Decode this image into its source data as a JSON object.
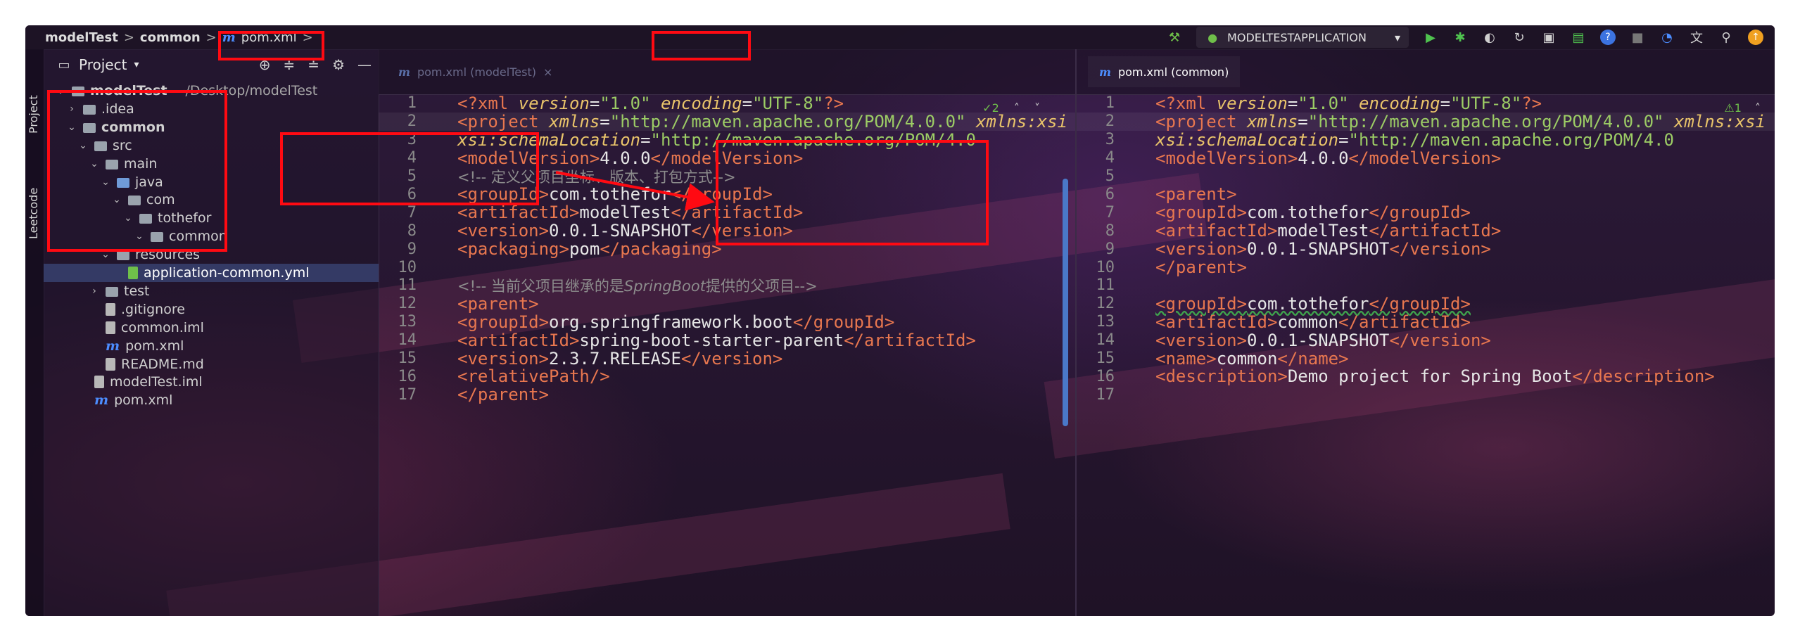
{
  "breadcrumb": {
    "items": [
      "modelTest",
      "common",
      "pom.xml"
    ],
    "separator": ">"
  },
  "toolbar": {
    "run_config": "MODELTESTAPPLICATION",
    "icons": [
      "hammer-icon",
      "run-config-icon",
      "run-icon",
      "debug-icon",
      "coverage-icon",
      "profile-icon",
      "build-icon",
      "layout-icon",
      "help-icon",
      "stop-icon",
      "search-everywhere-icon",
      "translate-icon",
      "search-icon",
      "update-icon"
    ]
  },
  "toolstrip": {
    "project_label": "Project",
    "leetcode_label": "Leetcode"
  },
  "project_panel": {
    "title": "Project",
    "tree": [
      {
        "label": "modelTest",
        "suffix": "~/Desktop/modelTest",
        "level": 0,
        "expanded": true,
        "kind": "folder"
      },
      {
        "label": ".idea",
        "level": 1,
        "expanded": false,
        "kind": "folder"
      },
      {
        "label": "common",
        "level": 1,
        "expanded": true,
        "kind": "module"
      },
      {
        "label": "src",
        "level": 2,
        "expanded": true,
        "kind": "folder"
      },
      {
        "label": "main",
        "level": 3,
        "expanded": true,
        "kind": "folder"
      },
      {
        "label": "java",
        "level": 4,
        "expanded": true,
        "kind": "source"
      },
      {
        "label": "com",
        "level": 5,
        "expanded": true,
        "kind": "package"
      },
      {
        "label": "tothefor",
        "level": 6,
        "expanded": true,
        "kind": "package"
      },
      {
        "label": "common",
        "level": 7,
        "expanded": true,
        "kind": "package"
      },
      {
        "label": "resources",
        "level": 4,
        "expanded": true,
        "kind": "resources"
      },
      {
        "label": "application-common.yml",
        "level": 5,
        "kind": "yml",
        "selected": true
      },
      {
        "label": "test",
        "level": 3,
        "expanded": false,
        "kind": "folder"
      },
      {
        "label": ".gitignore",
        "level": 3,
        "kind": "file"
      },
      {
        "label": "common.iml",
        "level": 3,
        "kind": "file"
      },
      {
        "label": "pom.xml",
        "level": 3,
        "kind": "maven"
      },
      {
        "label": "README.md",
        "level": 3,
        "kind": "file"
      },
      {
        "label": "modelTest.iml",
        "level": 2,
        "kind": "file"
      },
      {
        "label": "pom.xml",
        "level": 2,
        "kind": "maven"
      }
    ]
  },
  "left_editor": {
    "tab_label": "pom.xml (modelTest)",
    "inspection_count": "2",
    "lines": [
      {
        "n": "1",
        "html": "<span class='tag'>&lt;?xml </span><span class='attr'>version</span><span class='txt'>=</span><span class='str'>\"1.0\" </span><span class='attr'>encoding</span><span class='txt'>=</span><span class='str'>\"UTF-8\"</span><span class='tag'>?&gt;</span>"
      },
      {
        "n": "2",
        "html": "<span class='tag'>&lt;project </span><span class='attr'>xmlns</span><span class='txt'>=</span><span class='str'>\"http://maven.apache.org/POM/4.0.0\" </span><span class='attr'>xmlns:xsi</span>"
      },
      {
        "n": "3",
        "html": "<span class='txt'>         </span><span class='attr'>xsi:schemaLocation</span><span class='txt'>=</span><span class='str'>\"http://maven.apache.org/POM/4.0</span>"
      },
      {
        "n": "4",
        "html": "<span class='txt'>    </span><span class='tag'>&lt;modelVersion&gt;</span><span class='txt'>4.0.0</span><span class='tag'>&lt;/modelVersion&gt;</span>"
      },
      {
        "n": "5",
        "html": "<span class='txt'>    </span><span class='cmt'>&lt;!--     定义父项目坐标、版本、打包方式--&gt;</span>"
      },
      {
        "n": "6",
        "html": "<span class='txt'>    </span><span class='tag'>&lt;groupId&gt;</span><span class='txt'>com.tothefor</span><span class='tag'>&lt;/groupId&gt;</span>"
      },
      {
        "n": "7",
        "html": "<span class='txt'>    </span><span class='tag'>&lt;artifactId&gt;</span><span class='txt'>modelTest</span><span class='tag'>&lt;/artifactId&gt;</span>"
      },
      {
        "n": "8",
        "html": "<span class='txt'>    </span><span class='tag'>&lt;version&gt;</span><span class='txt'>0.0.1-SNAPSHOT</span><span class='tag'>&lt;/version&gt;</span>"
      },
      {
        "n": "9",
        "html": "<span class='txt'>    </span><span class='tag'>&lt;packaging&gt;</span><span class='txt'>pom</span><span class='tag'>&lt;/packaging&gt;</span>"
      },
      {
        "n": "10",
        "html": ""
      },
      {
        "n": "11",
        "html": "<span class='txt'>    </span><span class='cmt'>&lt;!--     当前父项目继承的是<i>SpringBoot</i>提供的父项目--&gt;</span>"
      },
      {
        "n": "12",
        "html": "<span class='txt'>    </span><span class='tag'>&lt;parent&gt;</span>"
      },
      {
        "n": "13",
        "html": "<span class='txt'>        </span><span class='tag'>&lt;groupId&gt;</span><span class='txt'>org.springframework.boot</span><span class='tag'>&lt;/groupId&gt;</span>"
      },
      {
        "n": "14",
        "html": "<span class='txt'>        </span><span class='tag'>&lt;artifactId&gt;</span><span class='txt'>spring-boot-starter-parent</span><span class='tag'>&lt;/artifactId&gt;</span>"
      },
      {
        "n": "15",
        "html": "<span class='txt'>        </span><span class='tag'>&lt;version&gt;</span><span class='txt'>2.3.7.RELEASE</span><span class='tag'>&lt;/version&gt;</span>"
      },
      {
        "n": "16",
        "html": "<span class='txt'>        </span><span class='tag'>&lt;relativePath/&gt;</span>"
      },
      {
        "n": "17",
        "html": "<span class='txt'>    </span><span class='tag'>&lt;/parent&gt;</span>"
      }
    ]
  },
  "right_editor": {
    "tab_label": "pom.xml (common)",
    "inspection_count": "1",
    "lines": [
      {
        "n": "1",
        "html": "<span class='tag'>&lt;?xml </span><span class='attr'>version</span><span class='txt'>=</span><span class='str'>\"1.0\" </span><span class='attr'>encoding</span><span class='txt'>=</span><span class='str'>\"UTF-8\"</span><span class='tag'>?&gt;</span>"
      },
      {
        "n": "2",
        "html": "<span class='tag'>&lt;project </span><span class='attr'>xmlns</span><span class='txt'>=</span><span class='str'>\"http://maven.apache.org/POM/4.0.0\" </span><span class='attr'>xmlns:xsi</span>"
      },
      {
        "n": "3",
        "html": "<span class='txt'>         </span><span class='attr'>xsi:schemaLocation</span><span class='txt'>=</span><span class='str'>\"http://maven.apache.org/POM/4.0</span>"
      },
      {
        "n": "4",
        "html": "<span class='txt'>    </span><span class='tag'>&lt;modelVersion&gt;</span><span class='txt'>4.0.0</span><span class='tag'>&lt;/modelVersion&gt;</span>"
      },
      {
        "n": "5",
        "html": ""
      },
      {
        "n": "6",
        "html": "<span class='txt'>    </span><span class='tag'>&lt;parent&gt;</span>"
      },
      {
        "n": "7",
        "html": "<span class='txt'>        </span><span class='tag'>&lt;groupId&gt;</span><span class='txt'>com.tothefor</span><span class='tag'>&lt;/groupId&gt;</span>"
      },
      {
        "n": "8",
        "html": "<span class='txt'>        </span><span class='tag'>&lt;artifactId&gt;</span><span class='txt'>modelTest</span><span class='tag'>&lt;/artifactId&gt;</span>"
      },
      {
        "n": "9",
        "html": "<span class='txt'>        </span><span class='tag'>&lt;version&gt;</span><span class='txt'>0.0.1-SNAPSHOT</span><span class='tag'>&lt;/version&gt;</span>"
      },
      {
        "n": "10",
        "html": "<span class='txt'>    </span><span class='tag'>&lt;/parent&gt;</span>"
      },
      {
        "n": "11",
        "html": ""
      },
      {
        "n": "12",
        "html": "<span class='txt'>    </span><span class='tag' style='text-decoration:underline wavy #3fa34d'>&lt;groupId&gt;</span><span class='txt' style='text-decoration:underline wavy #3fa34d'>com.tothefor</span><span class='tag' style='text-decoration:underline wavy #3fa34d'>&lt;/groupId&gt;</span>"
      },
      {
        "n": "13",
        "html": "<span class='txt'>    </span><span class='tag'>&lt;artifactId&gt;</span><span class='txt'>common</span><span class='tag'>&lt;/artifactId&gt;</span>"
      },
      {
        "n": "14",
        "html": "<span class='txt'>    </span><span class='tag'>&lt;version&gt;</span><span class='txt'>0.0.1-SNAPSHOT</span><span class='tag'>&lt;/version&gt;</span>"
      },
      {
        "n": "15",
        "html": "<span class='txt'>    </span><span class='tag'>&lt;name&gt;</span><span class='txt'>common</span><span class='tag'>&lt;/name&gt;</span>"
      },
      {
        "n": "16",
        "html": "<span class='txt'>    </span><span class='tag'>&lt;description&gt;</span><span class='txt'>Demo project for Spring Boot</span><span class='tag'>&lt;/description&gt;</span>"
      },
      {
        "n": "17",
        "html": ""
      }
    ]
  },
  "colors": {
    "annotation_red": "#ff0a12",
    "maven_blue": "#4c8dff",
    "tag_orange": "#e8774f",
    "attr_yellow": "#e9c46a",
    "string_green": "#9ccc65"
  }
}
